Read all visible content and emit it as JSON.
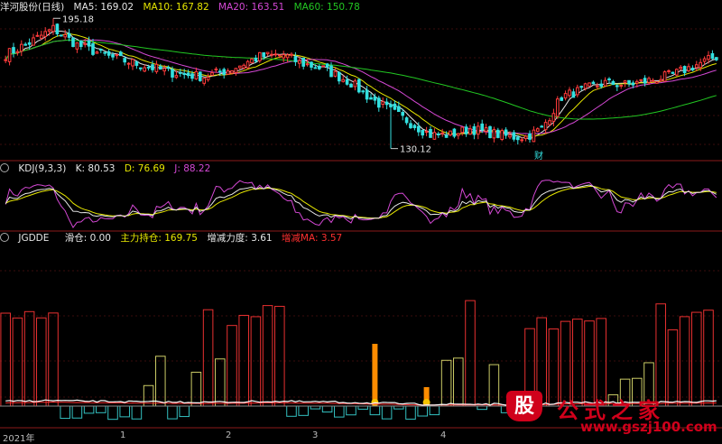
{
  "price_panel": {
    "stock_title": "洋河股份(日线)",
    "ma_labels": [
      {
        "text": "MA5: 169.02",
        "color": "#e6e6e6"
      },
      {
        "text": "MA10: 167.82",
        "color": "#e6e600"
      },
      {
        "text": "MA20: 163.51",
        "color": "#d448d4"
      },
      {
        "text": "MA60: 150.78",
        "color": "#22c722"
      }
    ],
    "high_label": "195.18",
    "low_label": "130.12",
    "event_marker": "财"
  },
  "kdj_panel": {
    "name": "KDJ(9,3,3)",
    "k_label": "K: 80.53",
    "d_label": "D: 76.69",
    "j_label": "J: 88.22",
    "colors": {
      "k": "#e6e6e6",
      "d": "#e6e600",
      "j": "#d448d4"
    }
  },
  "jgdde_panel": {
    "name": "JGDDE",
    "labels": [
      {
        "text": "滑仓: 0.00",
        "color": "#e6e6e6"
      },
      {
        "text": "主力持仓: 169.75",
        "color": "#e6e600"
      },
      {
        "text": "增减力度: 3.61",
        "color": "#e6e6e6"
      },
      {
        "text": "增减MA: 3.57",
        "color": "#ff3030"
      }
    ]
  },
  "x_axis": {
    "labels": [
      "2021年",
      "1",
      "2",
      "3",
      "4"
    ]
  },
  "watermark": {
    "badge": "股",
    "title": "公式之家",
    "url": "www.gszj100.com"
  },
  "chart_data": {
    "type": "candlestick",
    "panels": [
      "price",
      "kdj",
      "jgdde"
    ],
    "price": {
      "ylim": [
        125,
        198
      ],
      "high": 195.18,
      "low": 130.12,
      "close_anchors": [
        [
          0,
          177
        ],
        [
          6,
          183
        ],
        [
          12,
          190
        ],
        [
          18,
          182
        ],
        [
          26,
          176
        ],
        [
          34,
          172
        ],
        [
          42,
          168
        ],
        [
          50,
          166
        ],
        [
          57,
          170
        ],
        [
          64,
          176
        ],
        [
          70,
          177
        ],
        [
          74,
          173
        ],
        [
          80,
          170
        ],
        [
          87,
          163
        ],
        [
          92,
          155
        ],
        [
          97,
          149
        ],
        [
          102,
          143
        ],
        [
          107,
          137
        ],
        [
          112,
          137
        ],
        [
          117,
          140
        ],
        [
          122,
          138
        ],
        [
          127,
          136
        ],
        [
          131,
          136
        ],
        [
          135,
          140
        ],
        [
          140,
          156
        ],
        [
          146,
          160
        ],
        [
          151,
          163
        ],
        [
          156,
          162
        ],
        [
          162,
          164
        ],
        [
          168,
          167
        ],
        [
          174,
          172
        ],
        [
          179,
          176
        ]
      ],
      "ma_periods": [
        5,
        10,
        20,
        60
      ]
    },
    "kdj": {
      "ylim": [
        -15,
        120
      ],
      "k_final": 80.53,
      "d_final": 76.69,
      "j_final": 88.22
    },
    "jgdde": {
      "ylim": [
        -12,
        100
      ],
      "zero_line": 0
    }
  }
}
